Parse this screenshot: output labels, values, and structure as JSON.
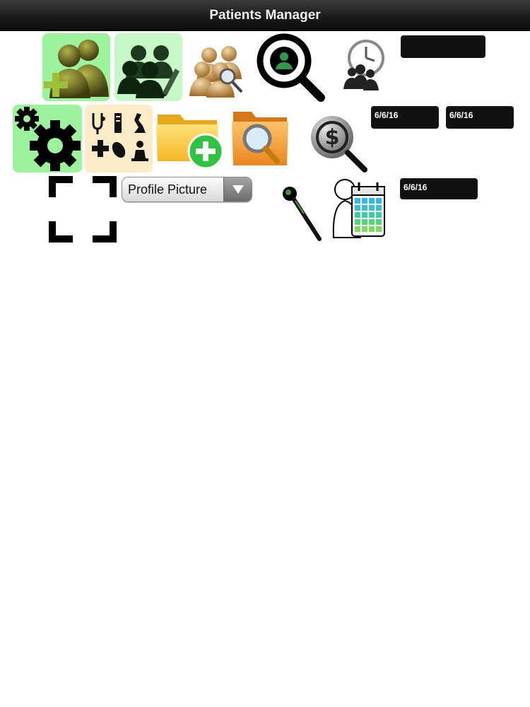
{
  "header": {
    "title": "Patients Manager"
  },
  "profile_picture_select": {
    "selected": "Profile Picture"
  },
  "date_fields": {
    "top_field": "",
    "start_date": "6/6/16",
    "end_date": "6/6/16",
    "appointment_date": "6/6/16"
  },
  "colors": {
    "accent_green": "#9cf39c",
    "light_green": "#c6f7c6",
    "cream": "#fcebc7",
    "field_bg": "#111111"
  },
  "icons": [
    "add-patient-icon",
    "edit-patients-icon",
    "search-patients-icon",
    "find-patient-icon",
    "patient-history-icon",
    "settings-icon",
    "medical-tools-icon",
    "new-folder-icon",
    "search-folder-icon",
    "billing-search-icon",
    "crop-frame-icon",
    "zoom-pin-icon",
    "patient-calendar-icon"
  ]
}
